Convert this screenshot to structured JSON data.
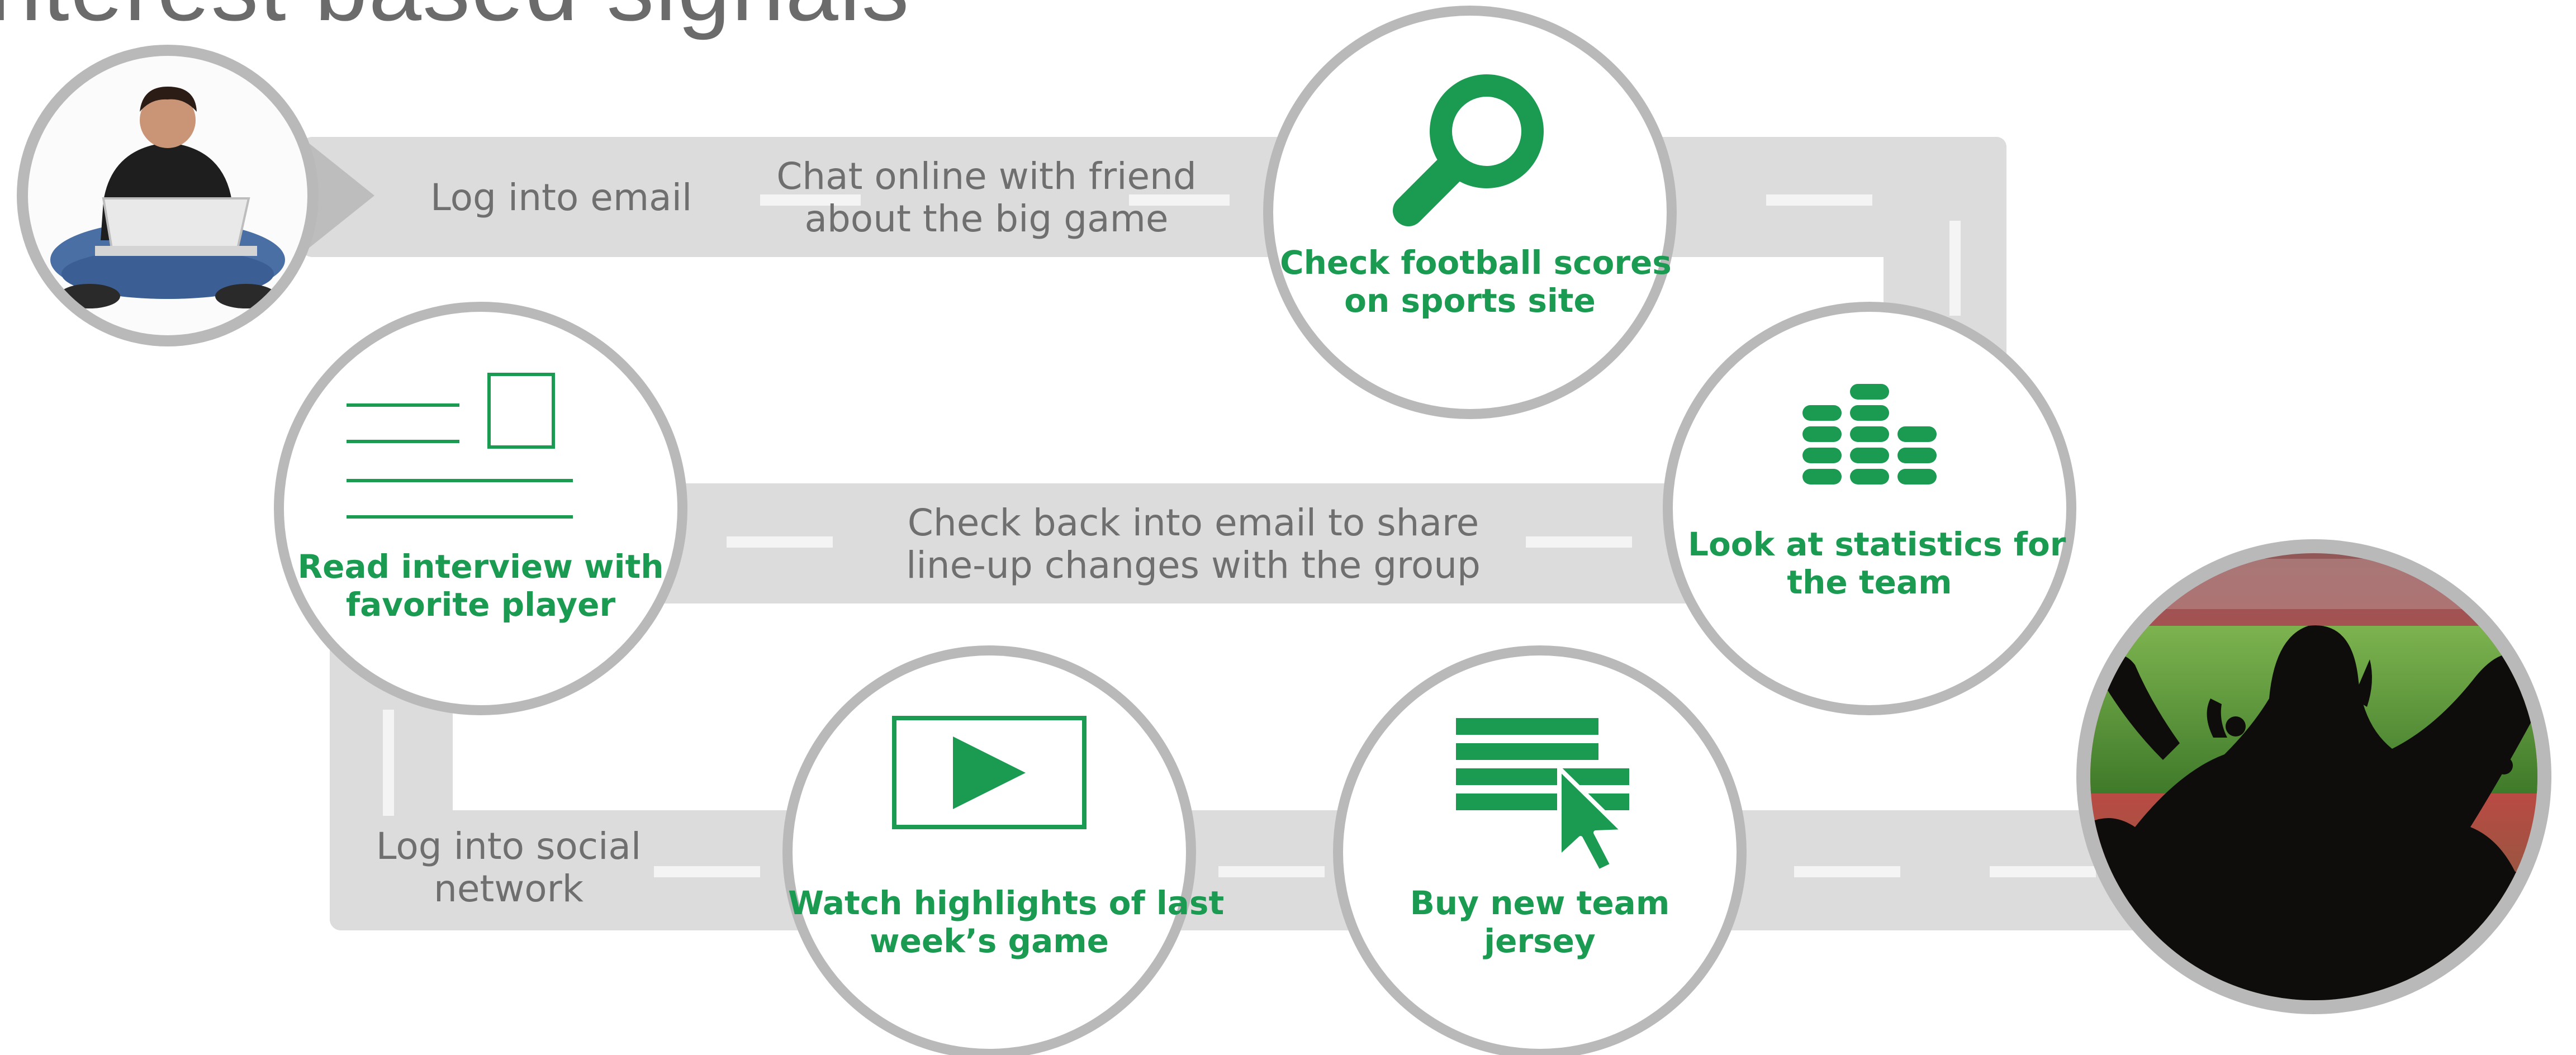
{
  "title": "nterest based signals",
  "steps": {
    "log_email": "Log into email",
    "chat_line1": "Chat online with friend",
    "chat_line2": "about the big game",
    "scores_line1": "Check football scores",
    "scores_line2": "on sports site",
    "stats_line1": "Look at statistics for",
    "stats_line2": "the team",
    "share_line1": "Check back into email to share",
    "share_line2": "line-up changes with the group",
    "interview_line1": "Read interview with",
    "interview_line2": "favorite player",
    "social_line1": "Log into social",
    "social_line2": "network",
    "watch_line1": "Watch highlights of last",
    "watch_line2": "week’s game",
    "jersey_line1": "Buy new team",
    "jersey_line2": "jersey"
  },
  "colors": {
    "accent_green": "#1b9a52",
    "road_gray": "#dcdcdc",
    "ring_gray": "#b9b9b9",
    "text_gray": "#6f6f6f"
  },
  "icons": [
    "person-laptop-photo",
    "magnifier-icon",
    "stats-stack-icon",
    "article-icon",
    "play-icon",
    "cart-list-icon",
    "fan-photo"
  ]
}
